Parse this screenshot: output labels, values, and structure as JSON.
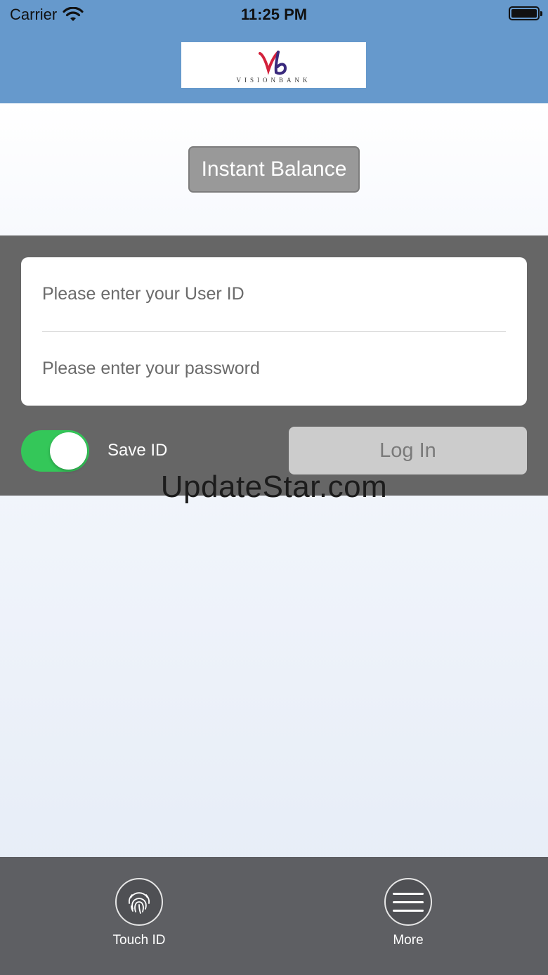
{
  "status_bar": {
    "carrier": "Carrier",
    "time": "11:25 PM"
  },
  "header": {
    "logo_word": "VISIONBANK",
    "background_color": "#6699cc"
  },
  "instant_balance": {
    "label": "Instant Balance"
  },
  "login_form": {
    "user_id_placeholder": "Please enter your User ID",
    "password_placeholder": "Please enter your password",
    "save_id_label": "Save ID",
    "save_id_enabled": true,
    "login_label": "Log In"
  },
  "watermark": "UpdateStar.com",
  "tab_bar": {
    "touch_id_label": "Touch ID",
    "touch_id_icon": "fingerprint-icon",
    "more_label": "More",
    "more_icon": "menu-icon"
  },
  "colors": {
    "toggle_on": "#34c759",
    "panel": "#666666",
    "tab_bar": "#5e5f63"
  }
}
